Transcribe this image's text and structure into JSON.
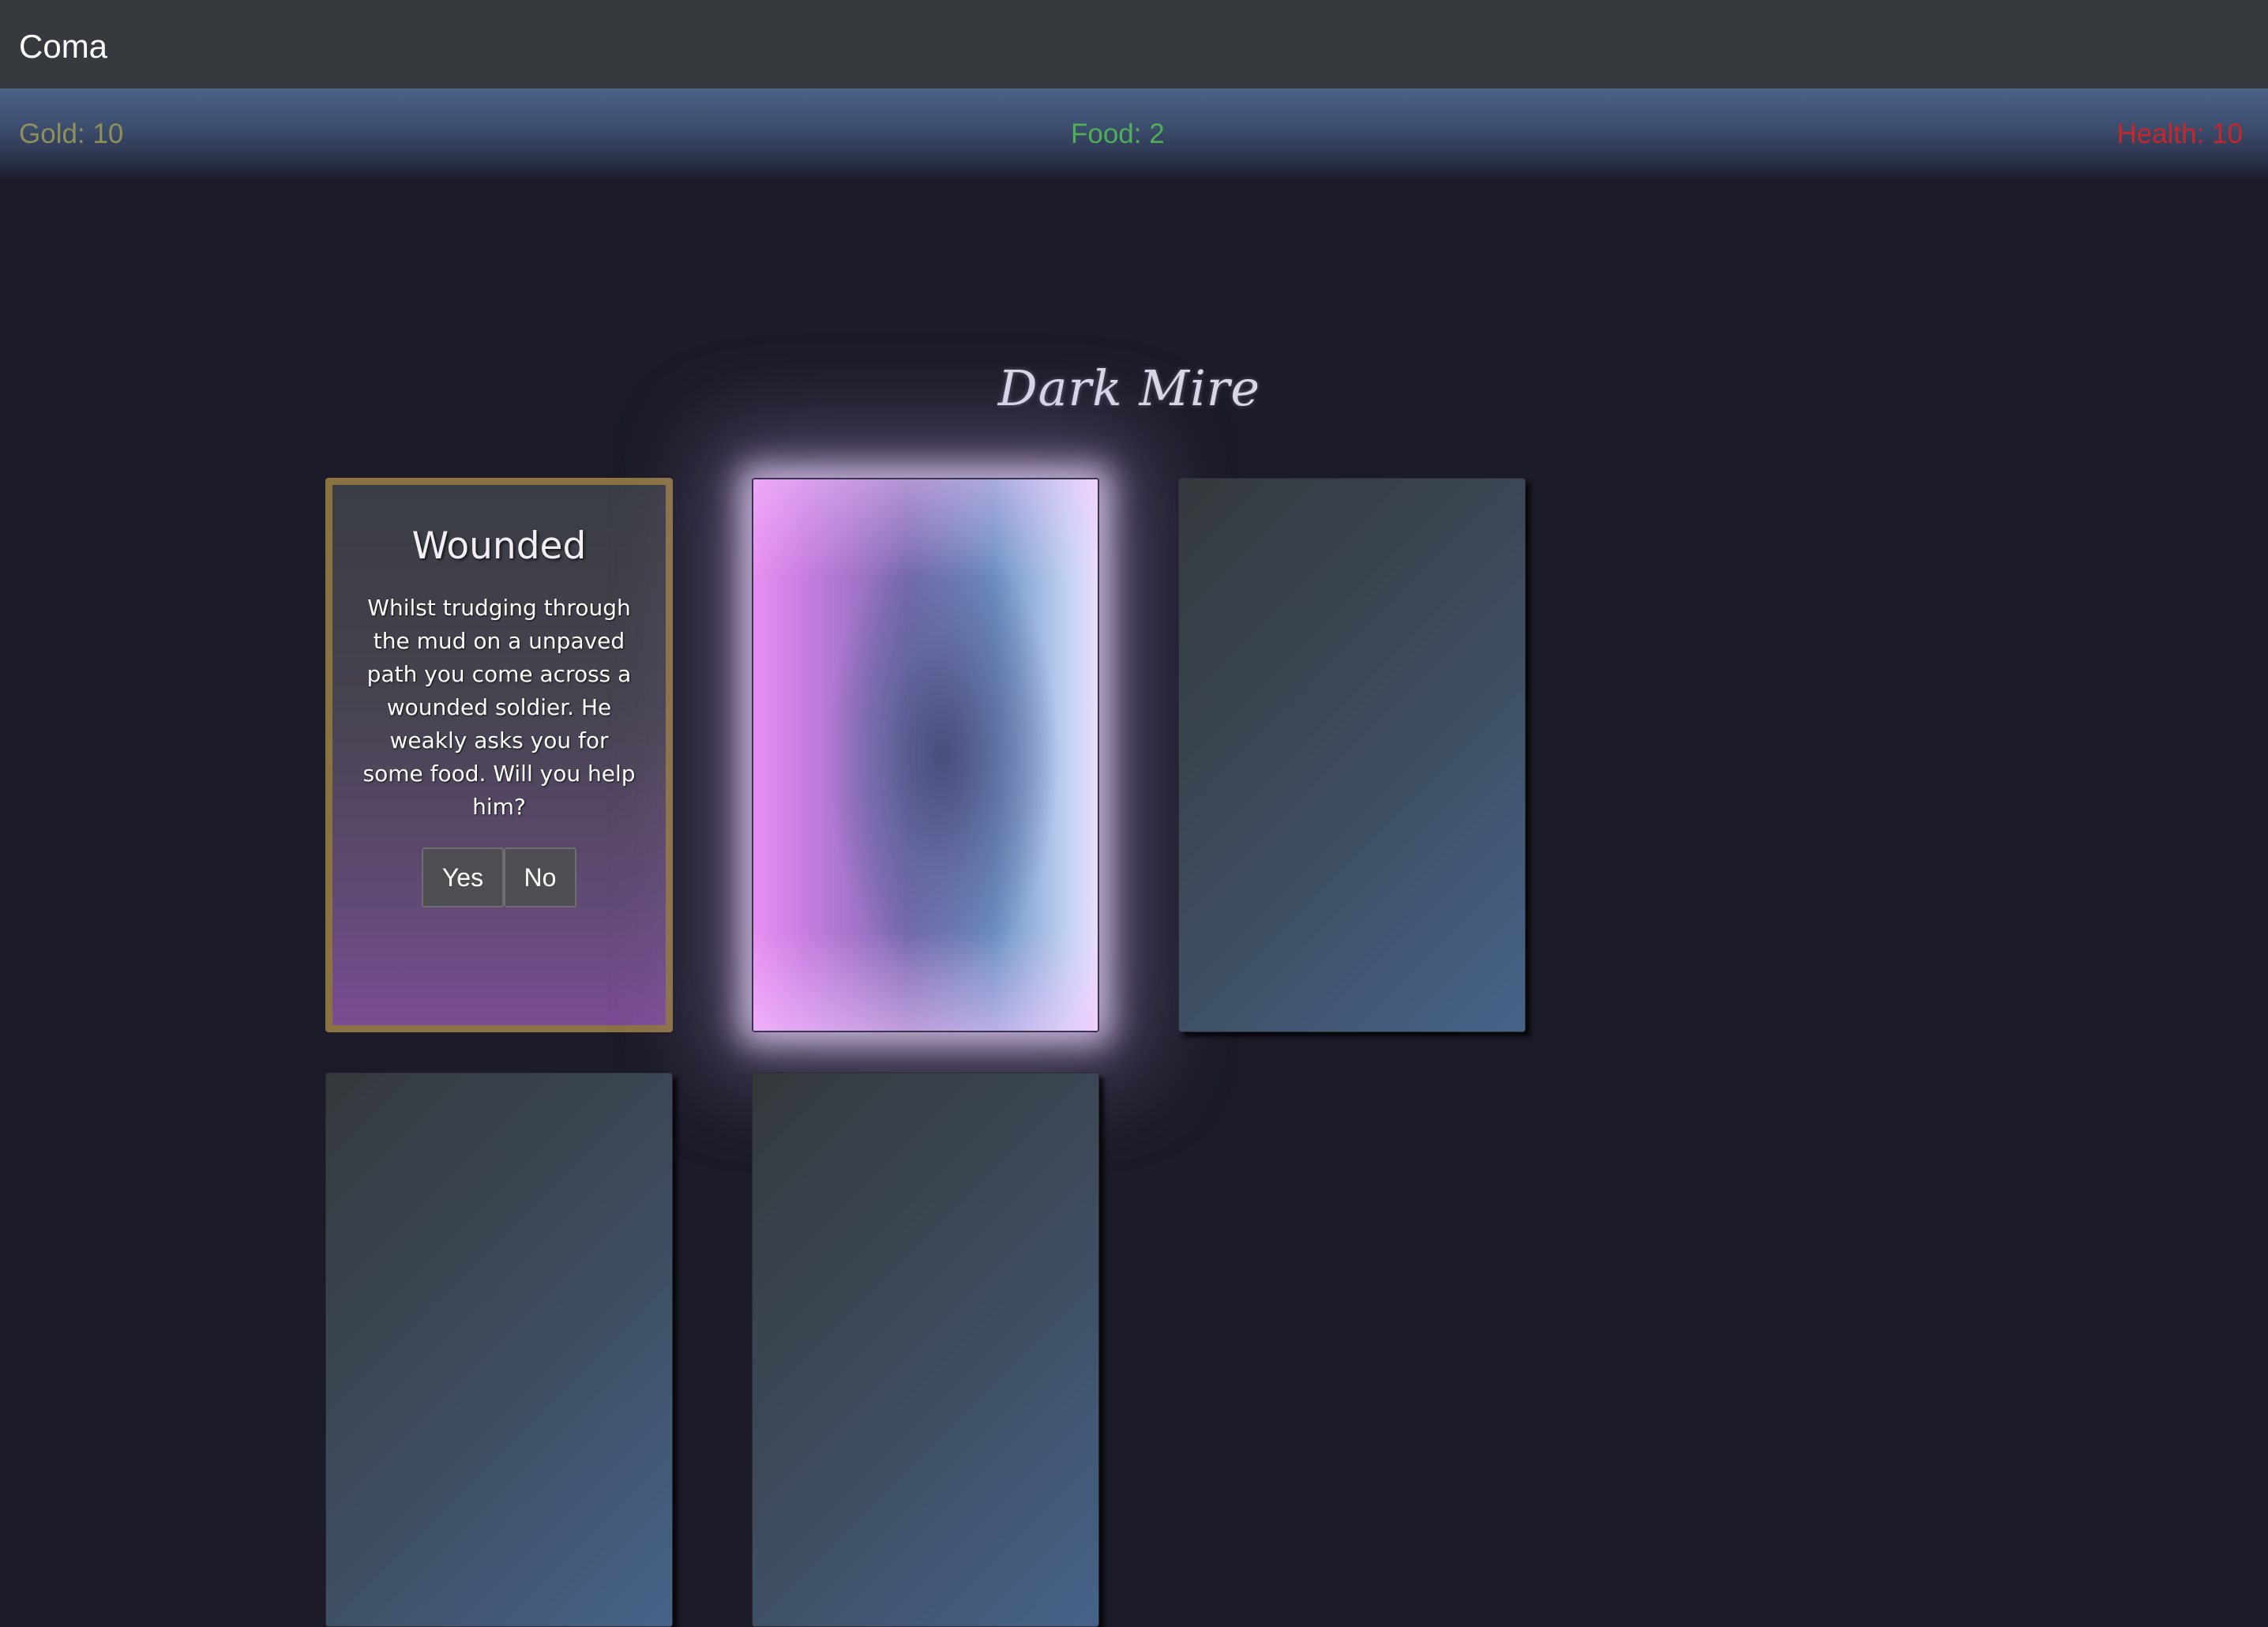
{
  "app": {
    "title": "Coma"
  },
  "stats": {
    "gold": "Gold: 10",
    "food": "Food: 2",
    "health": "Health: 10",
    "colors": {
      "gold": "#8f8f58",
      "food": "#4fae57",
      "health": "#c8262b"
    }
  },
  "location": {
    "name": "Dark Mire"
  },
  "event_card": {
    "title": "Wounded",
    "text": "Whilst trudging through the mud on a unpaved path you come across a wounded soldier. He weakly asks you for some food. Will you help him?",
    "choices": {
      "yes": "Yes",
      "no": "No"
    }
  },
  "colors": {
    "background": "#1c1b29",
    "card_border": "#8a7243",
    "glow": "#ebd7ff"
  }
}
